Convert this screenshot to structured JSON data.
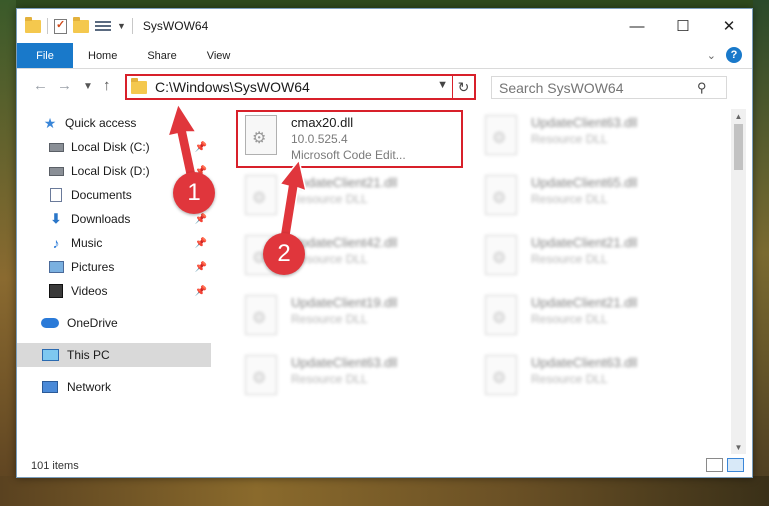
{
  "window": {
    "title": "SysWOW64"
  },
  "ribbon": {
    "file_tab": "File",
    "tabs": [
      "Home",
      "Share",
      "View"
    ]
  },
  "nav": {
    "address": "C:\\Windows\\SysWOW64",
    "search_placeholder": "Search SysWOW64"
  },
  "sidebar": {
    "quick_access": "Quick access",
    "items": [
      {
        "label": "Local Disk (C:)",
        "icon": "drive-icon",
        "pinned": true
      },
      {
        "label": "Local Disk (D:)",
        "icon": "drive-icon",
        "pinned": true
      },
      {
        "label": "Documents",
        "icon": "documents-icon",
        "pinned": true
      },
      {
        "label": "Downloads",
        "icon": "downloads-icon",
        "pinned": true
      },
      {
        "label": "Music",
        "icon": "music-icon",
        "pinned": true
      },
      {
        "label": "Pictures",
        "icon": "pictures-icon",
        "pinned": true
      },
      {
        "label": "Videos",
        "icon": "videos-icon",
        "pinned": true
      }
    ],
    "onedrive": "OneDrive",
    "this_pc": "This PC",
    "network": "Network"
  },
  "files": {
    "highlighted": {
      "name": "cmax20.dll",
      "version": "10.0.525.4",
      "company": "Microsoft Code Edit..."
    },
    "blurred": [
      {
        "name": "UpdateClient63.dll",
        "type": "Resource DLL"
      },
      {
        "name": "UpdateClient21.dll",
        "type": "Resource DLL"
      },
      {
        "name": "UpdateClient65.dll",
        "type": "Resource DLL"
      },
      {
        "name": "UpdateClient42.dll",
        "type": "Resource DLL"
      },
      {
        "name": "UpdateClient21.dll",
        "type": "Resource DLL"
      },
      {
        "name": "UpdateClient19.dll",
        "type": "Resource DLL"
      },
      {
        "name": "UpdateClient21.dll",
        "type": "Resource DLL"
      },
      {
        "name": "UpdateClient63.dll",
        "type": "Resource DLL"
      },
      {
        "name": "UpdateClient63.dll",
        "type": "Resource DLL"
      }
    ]
  },
  "status": {
    "item_count": "101 items"
  },
  "annotations": {
    "step1": "1",
    "step2": "2"
  },
  "colors": {
    "accent": "#1979ca",
    "annotation_red": "#d8202a"
  }
}
